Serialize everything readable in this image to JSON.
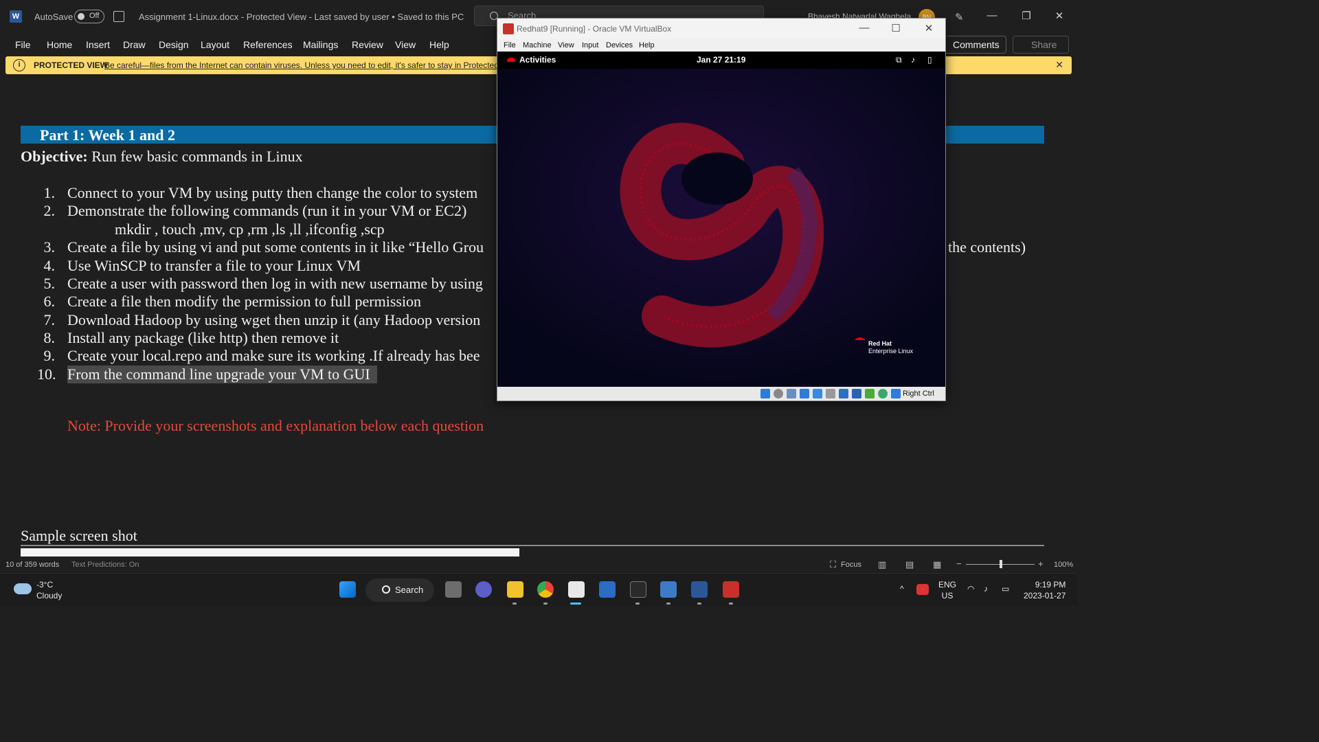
{
  "word": {
    "autosave_label": "AutoSave",
    "autosave_state": "Off",
    "doc_title": "Assignment 1-Linux.docx  -  Protected View  -  Last saved by user  •  Saved to this PC",
    "search_placeholder": "Search",
    "user_name": "Bhavesh Natwarlal Waghela",
    "user_initials": "BN",
    "menu": [
      "File",
      "Home",
      "Insert",
      "Draw",
      "Design",
      "Layout",
      "References",
      "Mailings",
      "Review",
      "View",
      "Help"
    ],
    "comments_label": "Comments",
    "share_label": "Share",
    "protected_label": "PROTECTED VIEW",
    "protected_msg": "Be careful—files from the Internet can contain viruses. Unless you need to edit, it's safer to stay in Protected View."
  },
  "document": {
    "part_heading": "Part 1: Week 1 and 2",
    "objective_label": "Objective:",
    "objective_text": " Run few basic commands in Linux",
    "items": [
      {
        "num": "1.",
        "text": "Connect to your VM by using putty then change the color to system"
      },
      {
        "num": "2.",
        "text": "Demonstrate the following commands (run it in your VM or EC2)"
      },
      {
        "num": "",
        "text": "mkdir , touch ,mv, cp ,rm ,ls ,ll ,ifconfig ,scp"
      },
      {
        "num": "3.",
        "text": "Create a file by using vi and put some contents in it like “Hello Grou"
      },
      {
        "num": "4.",
        "text": "Use WinSCP to transfer a file to your Linux VM"
      },
      {
        "num": "5.",
        "text": "Create a user with password then log in with new username by using"
      },
      {
        "num": "6.",
        "text": "Create a file then modify the permission to full permission"
      },
      {
        "num": "7.",
        "text": "Download Hadoop by using wget then unzip it (any Hadoop version"
      },
      {
        "num": "8.",
        "text": "Install any package (like http) then remove it"
      },
      {
        "num": "9.",
        "text": "Create your local.repo and make sure its working .If already has bee"
      },
      {
        "num": "10.",
        "text": "From the command line upgrade your VM to GUI"
      }
    ],
    "item3_tail": "the contents)",
    "note": "Note: Provide your screenshots and explanation below each question",
    "sample_heading": "Sample screen shot"
  },
  "status_bar": {
    "words": "10 of 359 words",
    "text_predictions": "Text Predictions: On",
    "focus": "Focus",
    "zoom": "100%",
    "zoom_level_percent": 100
  },
  "vbox": {
    "title": "Redhat9 [Running] - Oracle VM VirtualBox",
    "menu": [
      "File",
      "Machine",
      "View",
      "Input",
      "Devices",
      "Help"
    ],
    "gnome_activities": "Activities",
    "gnome_clock": "Jan 27  21:19",
    "brand_line1": "Red Hat",
    "brand_line2": "Enterprise Linux",
    "host_key": "Right Ctrl"
  },
  "taskbar": {
    "temp": "-3°C",
    "condition": "Cloudy",
    "search_label": "Search",
    "lang1": "ENG",
    "lang2": "US",
    "time": "9:19 PM",
    "date": "2023-01-27"
  },
  "colors": {
    "part_bar": "#0b6aa2",
    "note_red": "#e24a3b",
    "protected_yellow": "#fcd96b",
    "rhel_red": "#c2001a"
  }
}
